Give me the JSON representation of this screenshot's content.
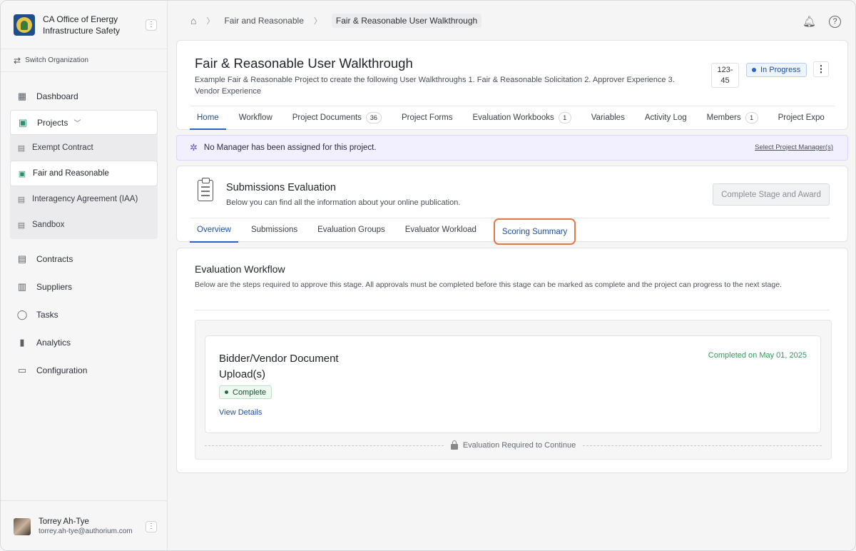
{
  "sidebar": {
    "org_name": "CA Office of Energy Infrastructure Safety",
    "switch_label": "Switch Organization",
    "nav": {
      "dashboard": "Dashboard",
      "projects": "Projects",
      "projects_sub": [
        "Exempt Contract",
        "Fair and Reasonable",
        "Interagency Agreement (IAA)",
        "Sandbox"
      ],
      "contracts": "Contracts",
      "suppliers": "Suppliers",
      "tasks": "Tasks",
      "analytics": "Analytics",
      "configuration": "Configuration"
    },
    "user": {
      "name": "Torrey Ah-Tye",
      "email": "torrey.ah-tye@authorium.com"
    }
  },
  "breadcrumb": {
    "parent": "Fair and Reasonable",
    "current": "Fair & Reasonable User Walkthrough"
  },
  "project": {
    "title": "Fair & Reasonable User Walkthrough",
    "description": "Example Fair & Reasonable Project to create the following User Walkthroughs 1. Fair & Reasonable Solicitation 2. Approver Experience 3. Vendor Experience",
    "id_line1": "123-",
    "id_line2": "45",
    "status": "In Progress",
    "tabs": {
      "home": "Home",
      "workflow": "Workflow",
      "documents": "Project Documents",
      "documents_count": "36",
      "forms": "Project Forms",
      "workbooks": "Evaluation Workbooks",
      "workbooks_count": "1",
      "variables": "Variables",
      "activity": "Activity Log",
      "members": "Members",
      "members_count": "1",
      "export": "Project Expo"
    }
  },
  "banner": {
    "text": "No Manager has been assigned for this project.",
    "link": "Select Project Manager(s)"
  },
  "evaluation": {
    "title": "Submissions Evaluation",
    "subtitle": "Below you can find all the information about your online publication.",
    "complete_button": "Complete Stage and Award",
    "tabs": {
      "overview": "Overview",
      "submissions": "Submissions",
      "groups": "Evaluation Groups",
      "workload": "Evaluator Workload",
      "scoring": "Scoring Summary"
    }
  },
  "workflow": {
    "title": "Evaluation Workflow",
    "description": "Below are the steps required to approve this stage. All approvals must be completed before this stage can be marked as complete and the project can progress to the next stage.",
    "step": {
      "title": "Bidder/Vendor Document Upload(s)",
      "completed_on": "Completed on May 01, 2025",
      "status": "Complete",
      "link": "View Details"
    },
    "gate_text": "Evaluation Required to Continue"
  },
  "colors": {
    "accent": "#2b62c8",
    "highlight": "#e07a47",
    "success": "#2f9c57",
    "banner": "#f2efff"
  }
}
